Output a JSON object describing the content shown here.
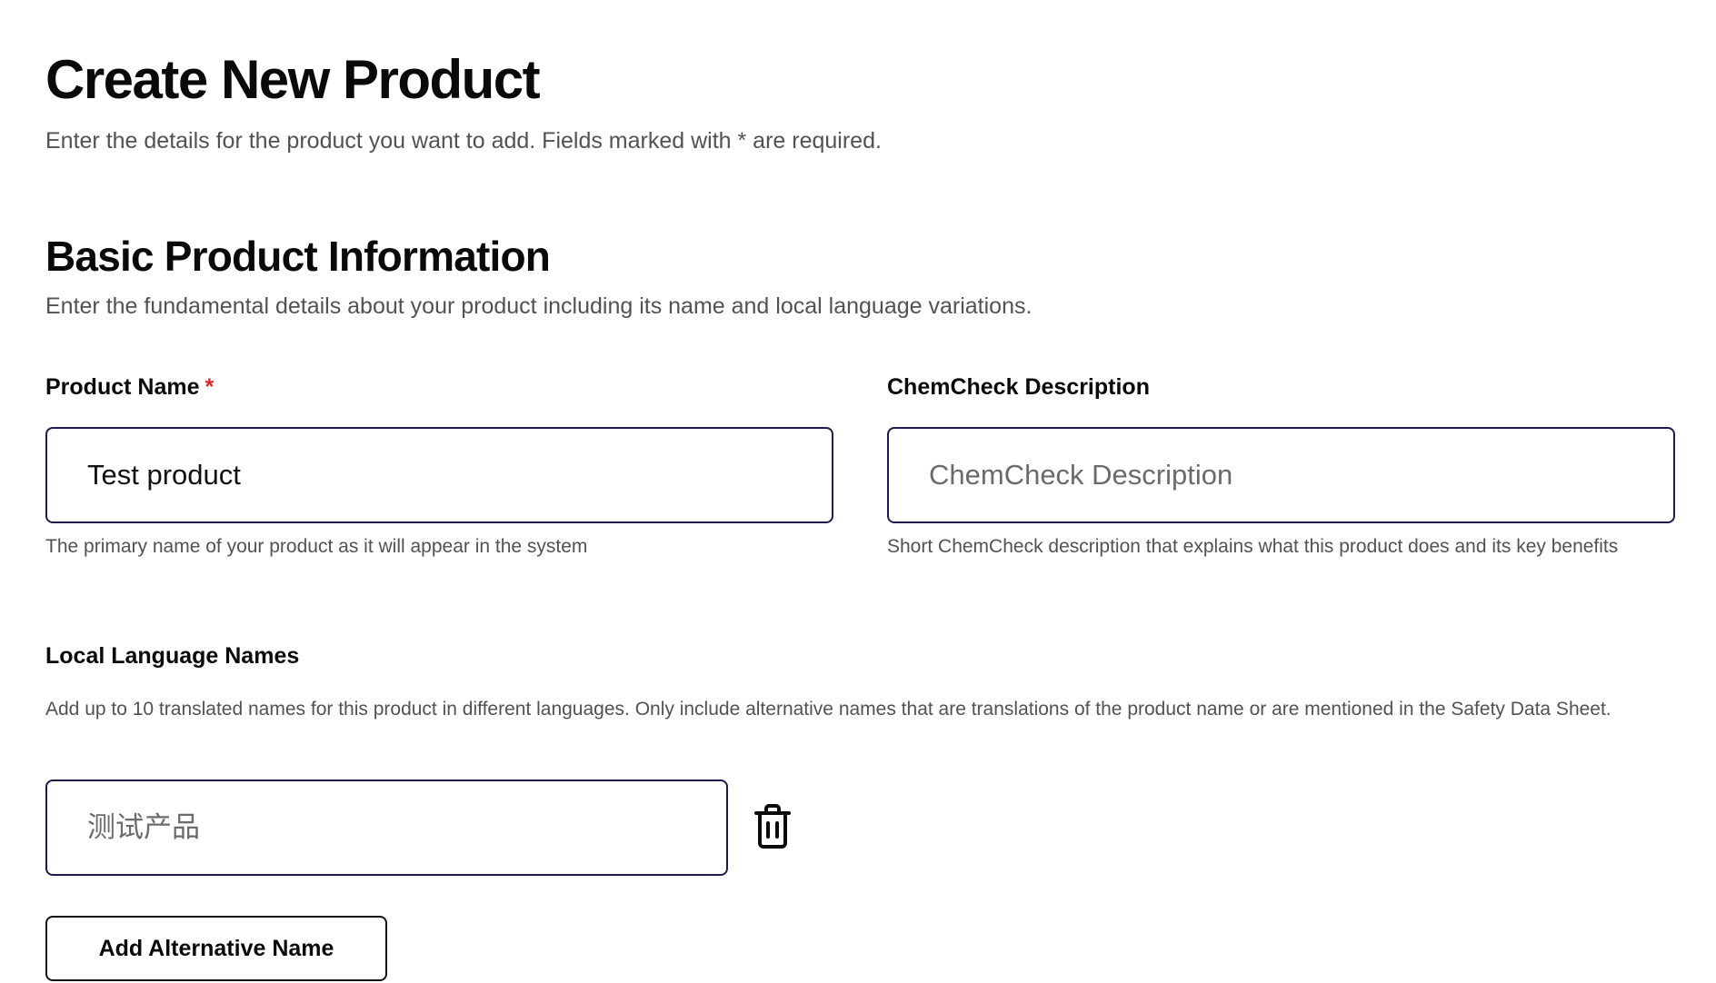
{
  "header": {
    "title": "Create New Product",
    "subtitle": "Enter the details for the product you want to add. Fields marked with * are required."
  },
  "basic_info": {
    "title": "Basic Product Information",
    "description": "Enter the fundamental details about your product including its name and local language variations."
  },
  "product_name": {
    "label": "Product Name",
    "required_mark": "*",
    "value": "Test product",
    "help": "The primary name of your product as it will appear in the system"
  },
  "chemcheck": {
    "label": "ChemCheck Description",
    "placeholder": "ChemCheck Description",
    "value": "",
    "help": "Short ChemCheck description that explains what this product does and its key benefits"
  },
  "local_names": {
    "label": "Local Language Names",
    "description": "Add up to 10 translated names for this product in different languages. Only include alternative names that are translations of the product name or are mentioned in the Safety Data Sheet.",
    "items": [
      {
        "placeholder": "测试产品",
        "value": ""
      }
    ],
    "delete_icon": "trash-icon",
    "add_button_label": "Add Alternative Name"
  }
}
